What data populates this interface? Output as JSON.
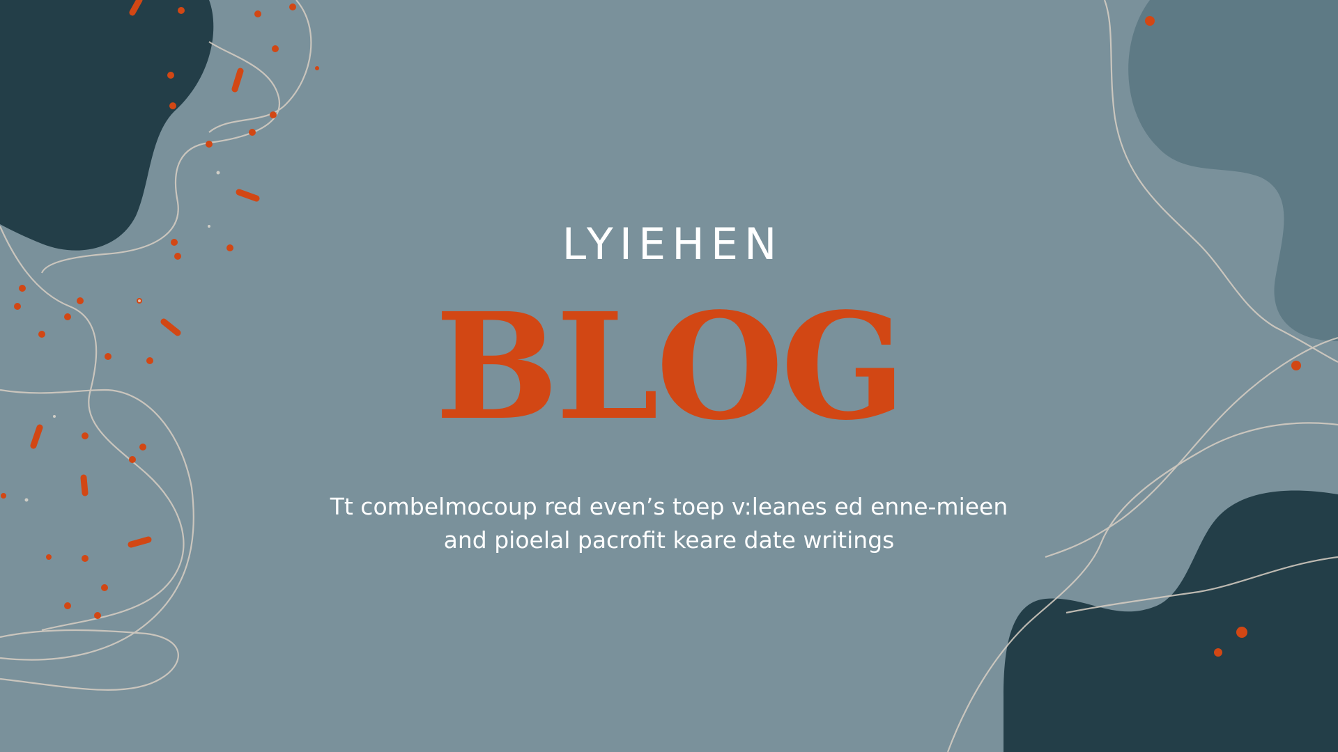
{
  "brand": {
    "name": "LYIEHEN"
  },
  "hero": {
    "title": "BLOG",
    "tagline_line1": "Tt combelmocoup red even’s toep v:leanes ed enne-mieen",
    "tagline_line2": "and pioelal pacrofit keare date writings"
  },
  "colors": {
    "background": "#7a919b",
    "dark_blob": "#233e48",
    "light_blob": "#5e7a85",
    "accent": "#d24714",
    "line": "#d8cfc4",
    "text": "#ffffff"
  },
  "decor": {
    "left_icon": "abstract-blob-icon",
    "right_icon": "abstract-blob-icon",
    "dot_icon": "confetti-dot-icon"
  }
}
